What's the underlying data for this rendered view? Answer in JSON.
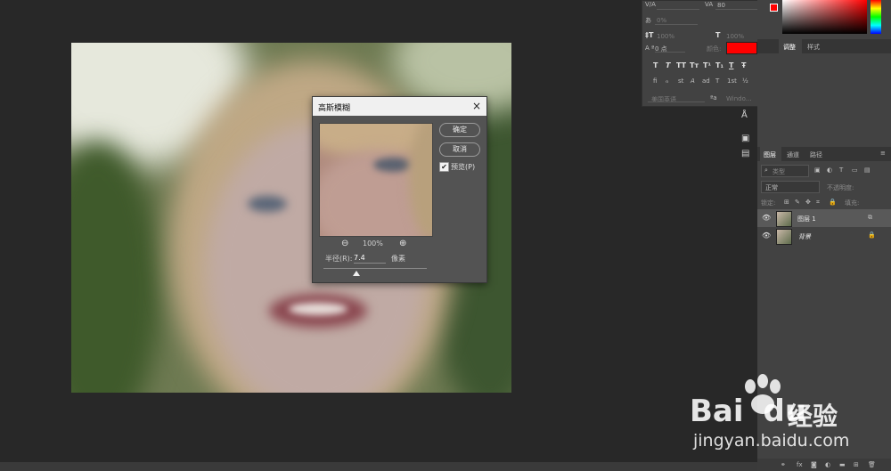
{
  "dialog": {
    "title": "高斯模糊",
    "close_glyph": "×",
    "ok_label": "确定",
    "cancel_label": "取消",
    "preview_label": "预览(P)",
    "preview_checked": true,
    "zoom_level": "100%",
    "radius_label": "半径(R):",
    "radius_value": "7.4",
    "radius_unit": "像素"
  },
  "character_panel": {
    "tracking_value": "80",
    "leading_value": "0%",
    "vscale_value": "100%",
    "hscale_value": "100%",
    "baseline_value": "0 点",
    "color_label": "颜色:",
    "color_value": "#ff0000",
    "language_value": "美国英语",
    "aa_value": "Windo...",
    "style_row1": [
      "T",
      "T",
      "TT",
      "Tт",
      "T¹",
      "T₁",
      "T",
      "Ŧ"
    ],
    "style_row2": [
      "fi",
      "ℴ",
      "st",
      "A",
      "ad",
      "T",
      "1st",
      "½"
    ]
  },
  "right_panels": {
    "top_tabs": [
      "调整",
      "样式"
    ],
    "layers_tabs": [
      "图层",
      "通道",
      "路径"
    ],
    "filter_placeholder": "类型",
    "blend_mode": "正常",
    "opacity_label": "不透明度:",
    "lock_label": "锁定:",
    "fill_label": "填充:",
    "layers": [
      {
        "name": "图层 1",
        "selected": true
      },
      {
        "name": "背景",
        "selected": false
      }
    ],
    "bottom_icons": [
      "link-icon",
      "fx-icon",
      "mask-icon",
      "adjustment-icon",
      "folder-icon",
      "new-layer-icon",
      "trash-icon"
    ]
  },
  "watermark": {
    "brand_text": "Bai",
    "brand_text2": "du",
    "brand_cn": "经验",
    "url": "jingyan.baidu.com"
  },
  "colors": {
    "accent_blue": "#1f6fd0",
    "foreground": "#ff0000",
    "panel_bg": "#424242",
    "app_bg": "#282828"
  }
}
